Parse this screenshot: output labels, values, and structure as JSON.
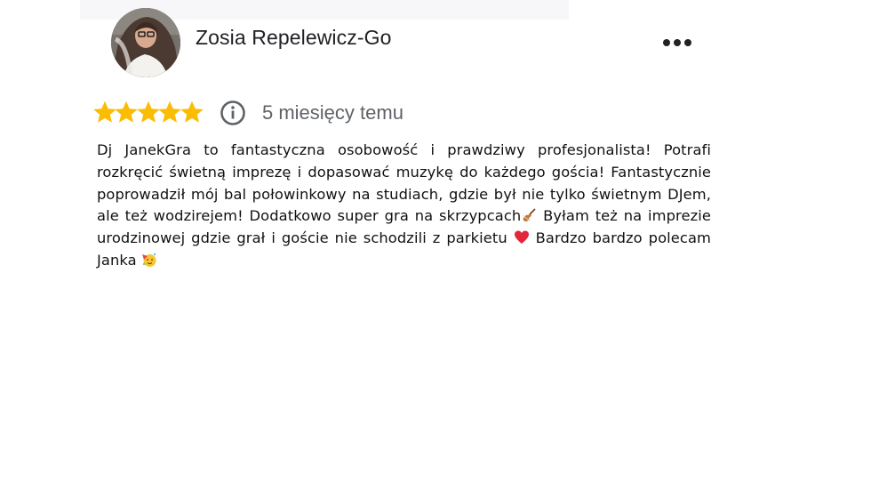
{
  "review": {
    "author": "Zosia Repelewicz-Go",
    "rating": 5,
    "max_rating": 5,
    "time_ago": "5 miesięcy temu",
    "text_parts": [
      "Dj JanekGra to fantastyczna osobowość i prawdziwy profesjonalista! Potrafi rozkręcić świetną imprezę i dopasować muzykę do każdego gościa! Fantastycznie poprowadził mój bal połowinkowy na studiach, gdzie był nie tylko świetnym DJem, ale też wodzirejem! Dodatkowo super gra na skrzypcach",
      " Byłam też na imprezie urodzinowej gdzie grał i goście nie schodzili z parkietu ",
      " Bardzo bardzo polecam Janka"
    ],
    "emojis": [
      "violin-emoji",
      "red-heart-emoji",
      "partying-face-emoji"
    ]
  },
  "icons": {
    "menu": "more-horizontal-icon",
    "info": "info-icon",
    "star": "star-icon"
  },
  "colors": {
    "star": "#fbbc04",
    "heart": "#e0283a",
    "text_secondary": "#5f6368",
    "text_primary": "#202124"
  }
}
